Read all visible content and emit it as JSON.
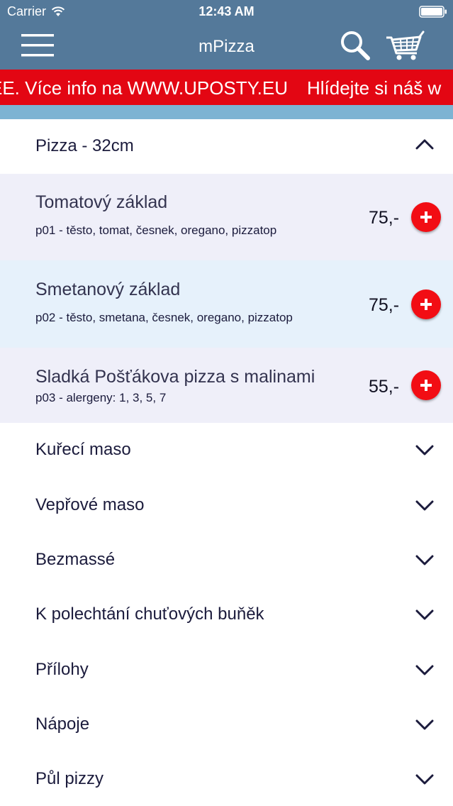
{
  "status_bar": {
    "carrier": "Carrier",
    "time": "12:43 AM"
  },
  "navbar": {
    "title": "mPizza",
    "menu_icon": "hamburger-menu-icon",
    "search_icon": "search-icon",
    "cart_icon": "shopping-cart-icon"
  },
  "ticker": {
    "message_1": "EE. Více info na WWW.UPOSTY.EU",
    "message_2": "Hlídejte si náš w"
  },
  "colors": {
    "header": "#54799a",
    "ticker": "#e30613",
    "strip": "#7db3d3",
    "add_button": "#f20d14",
    "row_odd": "#efeff9",
    "row_even": "#e6f1fb"
  },
  "menu": {
    "expanded_category": {
      "title": "Pizza - 32cm",
      "items": [
        {
          "name": "Tomatový základ",
          "description": "p01 - těsto, tomat, česnek, oregano, pizzatop",
          "price": "75,-"
        },
        {
          "name": "Smetanový základ",
          "description": "p02 - těsto, smetana, česnek, oregano, pizzatop",
          "price": "75,-"
        },
        {
          "name": "Sladká Pošťákova pizza s malinami",
          "description": "p03 - alergeny: 1, 3, 5, 7",
          "price": "55,-"
        }
      ]
    },
    "categories": [
      {
        "title": "Kuřecí maso"
      },
      {
        "title": "Vepřové maso"
      },
      {
        "title": "Bezmassé"
      },
      {
        "title": "K polechtání chuťových buňěk"
      },
      {
        "title": "Přílohy"
      },
      {
        "title": "Nápoje"
      },
      {
        "title": "Půl pizzy"
      }
    ]
  }
}
